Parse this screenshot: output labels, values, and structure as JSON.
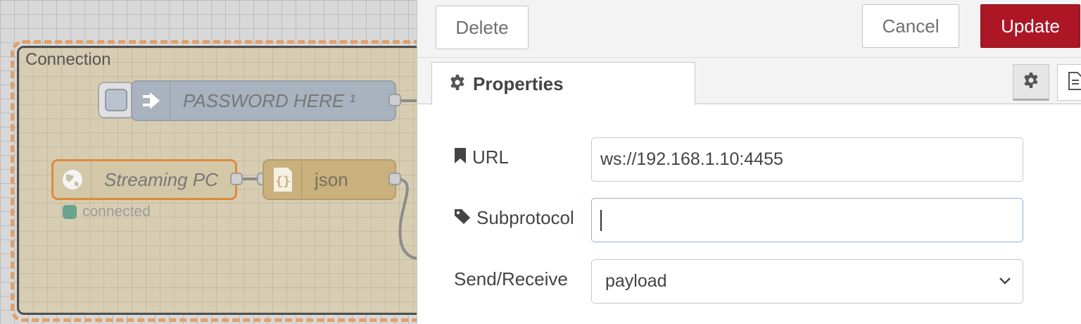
{
  "canvas": {
    "group_label": "Connection",
    "inject_node_label": "PASSWORD HERE ¹",
    "websocket_node_label": "Streaming PC",
    "json_node_label": "json",
    "status_text": "connected",
    "icons": [
      "arrow-right-icon",
      "globe-icon",
      "braces-icon"
    ]
  },
  "toolbar": {
    "delete_label": "Delete",
    "cancel_label": "Cancel",
    "update_label": "Update"
  },
  "tabs": {
    "properties_label": "Properties",
    "icons": [
      "gear-icon",
      "document-icon"
    ]
  },
  "form": {
    "url_label": "URL",
    "url_value": "ws://192.168.1.10:4455",
    "subprotocol_label": "Subprotocol",
    "subprotocol_value": "",
    "send_receive_label": "Send/Receive",
    "send_receive_value": "payload"
  },
  "colors": {
    "update_button": "#ad1625",
    "group_outline": "#e2a06a",
    "selected_node_border": "#e08a3c",
    "status_dot": "#6aa38e"
  }
}
